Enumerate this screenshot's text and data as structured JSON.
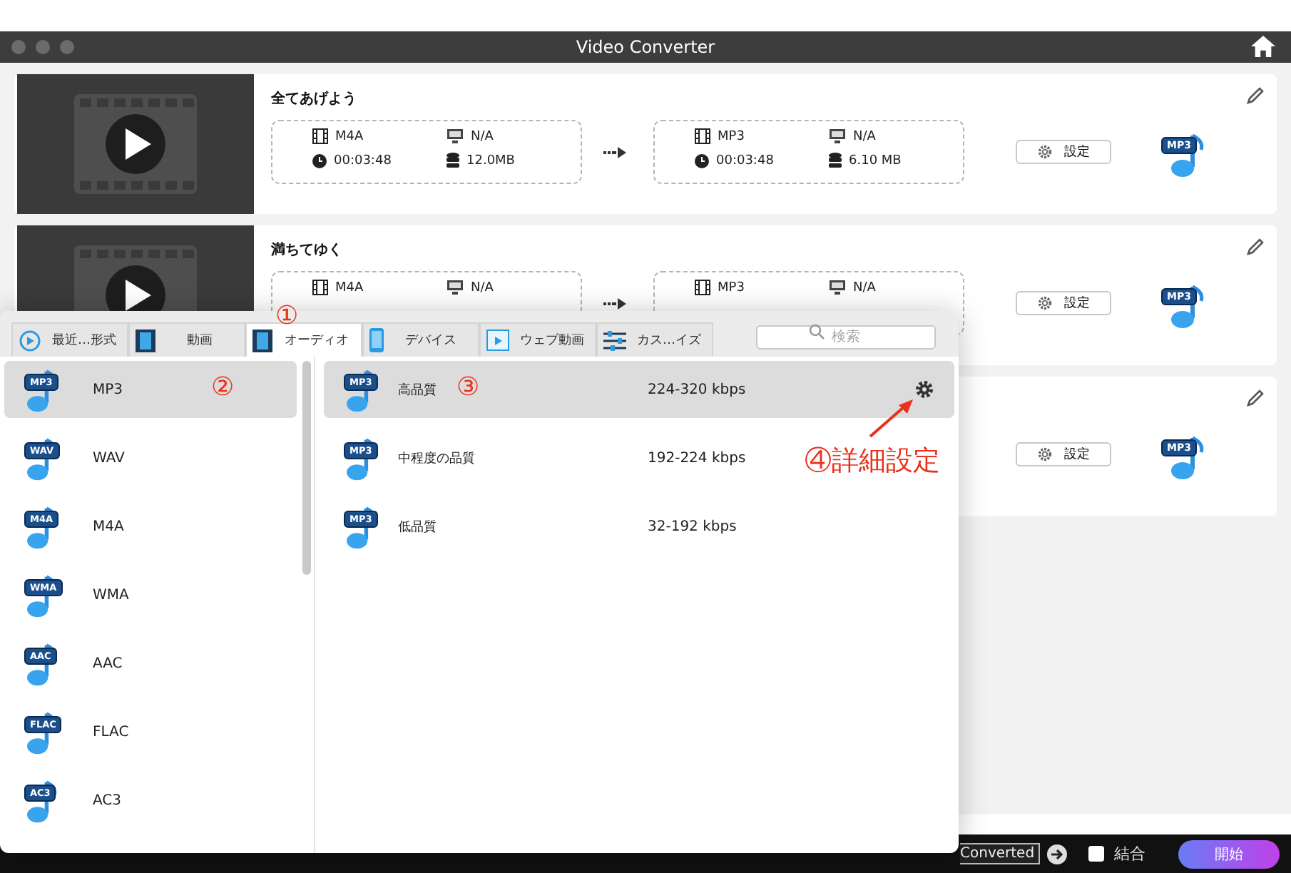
{
  "window": {
    "title": "Video Converter"
  },
  "tasks": [
    {
      "title": "全てあげよう",
      "source": {
        "format": "M4A",
        "resolution": "N/A",
        "duration": "00:03:48",
        "size": "12.0MB"
      },
      "target": {
        "format": "MP3",
        "resolution": "N/A",
        "duration": "00:03:48",
        "size": "6.10 MB"
      },
      "settings_label": "設定",
      "output_badge": "MP3"
    },
    {
      "title": "満ちてゆく",
      "source": {
        "format": "M4A",
        "resolution": "N/A"
      },
      "target": {
        "format": "MP3",
        "resolution": "N/A"
      },
      "settings_label": "設定",
      "output_badge": "MP3"
    },
    {
      "settings_label": "設定",
      "output_badge": "MP3"
    }
  ],
  "format_panel": {
    "tabs": [
      {
        "label": "最近…形式",
        "selected": false
      },
      {
        "label": "動画",
        "selected": false
      },
      {
        "label": "オーディオ",
        "selected": true
      },
      {
        "label": "デバイス",
        "selected": false
      },
      {
        "label": "ウェブ動画",
        "selected": false
      },
      {
        "label": "カス…イズ",
        "selected": false
      }
    ],
    "search": {
      "placeholder": "検索"
    },
    "formats": [
      {
        "label": "MP3",
        "badge": "MP3",
        "selected": true
      },
      {
        "label": "WAV",
        "badge": "WAV",
        "selected": false
      },
      {
        "label": "M4A",
        "badge": "M4A",
        "selected": false
      },
      {
        "label": "WMA",
        "badge": "WMA",
        "selected": false
      },
      {
        "label": "AAC",
        "badge": "AAC",
        "selected": false
      },
      {
        "label": "FLAC",
        "badge": "FLAC",
        "selected": false
      },
      {
        "label": "AC3",
        "badge": "AC3",
        "selected": false
      }
    ],
    "qualities": [
      {
        "label": "高品質",
        "bitrate": "224-320 kbps",
        "badge": "MP3",
        "selected": true
      },
      {
        "label": "中程度の品質",
        "bitrate": "192-224 kbps",
        "badge": "MP3",
        "selected": false
      },
      {
        "label": "低品質",
        "bitrate": "32-192 kbps",
        "badge": "MP3",
        "selected": false
      }
    ]
  },
  "annotations": [
    "①",
    "②",
    "③",
    "④詳細設定"
  ],
  "bottom_bar": {
    "output_path": "Converted",
    "merge": {
      "label": "結合",
      "checked": false
    },
    "start_label": "開始"
  }
}
